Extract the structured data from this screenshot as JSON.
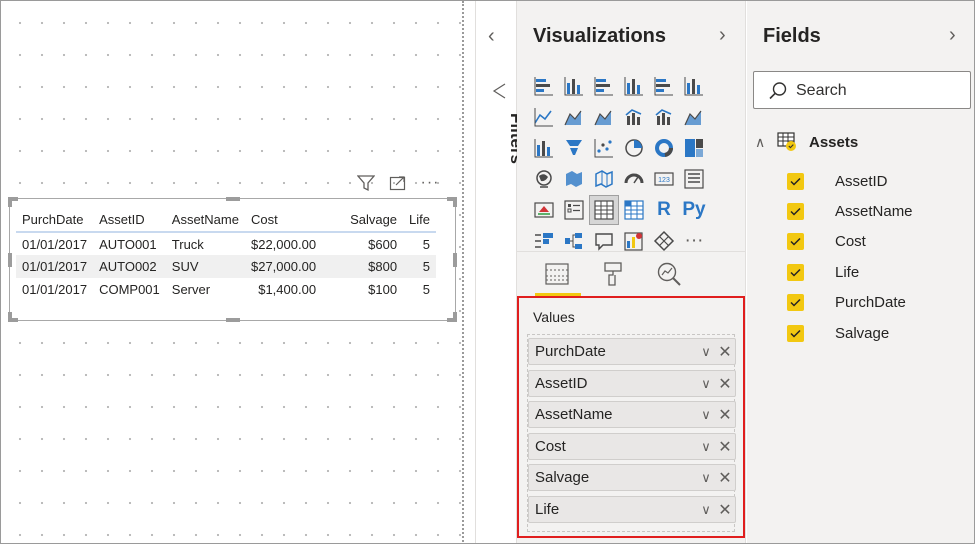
{
  "table_visual": {
    "columns": [
      "PurchDate",
      "AssetID",
      "AssetName",
      "Cost",
      "Salvage",
      "Life"
    ],
    "rows": [
      [
        "01/01/2017",
        "AUTO001",
        "Truck",
        "$22,000.00",
        "$600",
        "5"
      ],
      [
        "01/01/2017",
        "AUTO002",
        "SUV",
        "$27,000.00",
        "$800",
        "5"
      ],
      [
        "01/01/2017",
        "COMP001",
        "Server",
        "$1,400.00",
        "$100",
        "5"
      ]
    ]
  },
  "filters": {
    "label": "Filters"
  },
  "visualizations": {
    "title": "Visualizations",
    "icons": [
      "stacked-bar-chart",
      "stacked-column-chart",
      "clustered-bar-chart",
      "clustered-column-chart",
      "100-stacked-bar-chart",
      "100-stacked-column-chart",
      "line-chart",
      "area-chart",
      "stacked-area-chart",
      "line-and-stacked-column-chart",
      "line-and-clustered-column-chart",
      "ribbon-chart",
      "waterfall-chart",
      "funnel-chart",
      "scatter-chart",
      "pie-chart",
      "donut-chart",
      "treemap",
      "map",
      "filled-map",
      "shape-map",
      "gauge",
      "card",
      "multi-row-card",
      "kpi",
      "slicer",
      "table",
      "matrix",
      "r-script-visual",
      "python-visual",
      "key-influencers",
      "decomposition-tree",
      "qna",
      "custom-visual",
      "arcgis-map",
      "more-visuals"
    ],
    "r_glyph": "R",
    "py_glyph": "Py",
    "more_glyph": "···",
    "values_label": "Values",
    "values": [
      "PurchDate",
      "AssetID",
      "AssetName",
      "Cost",
      "Salvage",
      "Life"
    ]
  },
  "fields_pane": {
    "title": "Fields",
    "search_placeholder": "Search",
    "table_name": "Assets",
    "fields": [
      "AssetID",
      "AssetName",
      "Cost",
      "Life",
      "PurchDate",
      "Salvage"
    ]
  },
  "colors": {
    "accent": "#f2c811",
    "highlight_border": "#e01e1e",
    "icon_blue": "#2b77c5"
  }
}
